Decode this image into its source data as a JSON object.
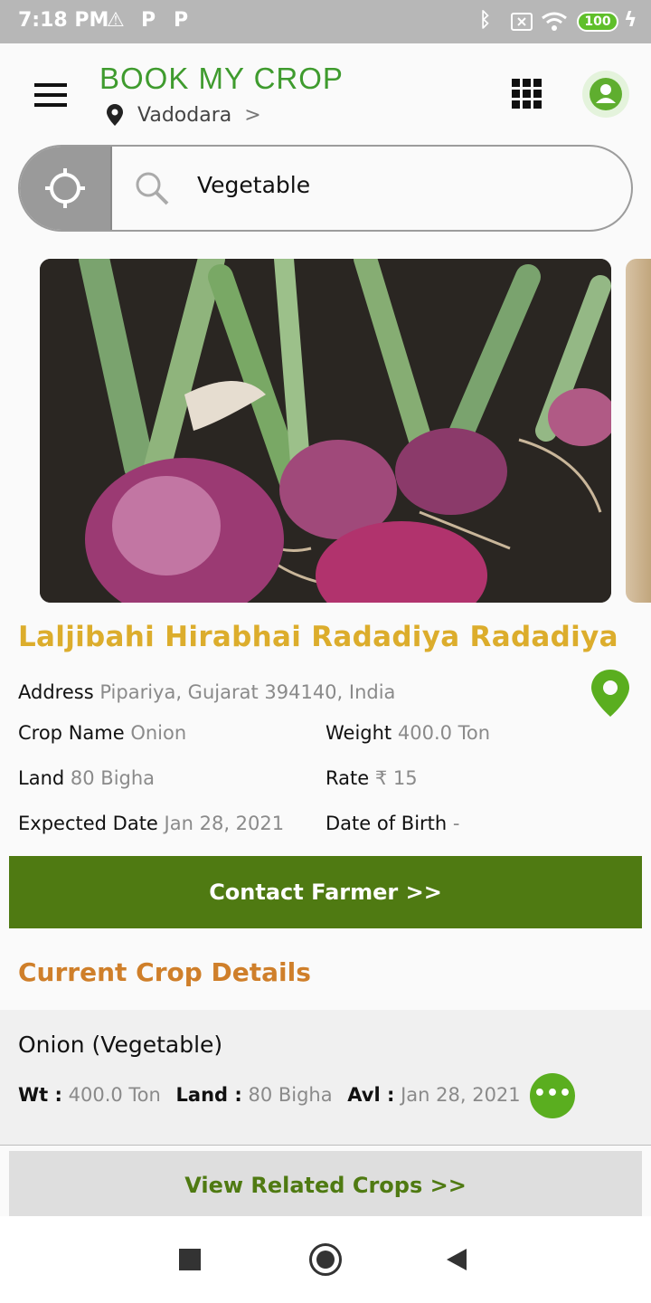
{
  "status_bar": {
    "time": "7:18 PM",
    "notif_icons": [
      "warning-icon",
      "p-icon",
      "p-icon"
    ],
    "battery": "100"
  },
  "header": {
    "logo": "BOOK MY CROP",
    "city": "Vadodara",
    "chevron": ">"
  },
  "search": {
    "query": "Vegetable"
  },
  "farmer": {
    "name": "Laljibahi Hirabhai Radadiya Radadiya",
    "address_label": "Address",
    "address_value": "Pipariya, Gujarat 394140, India",
    "crop_name_label": "Crop Name",
    "crop_name_value": "Onion",
    "weight_label": "Weight",
    "weight_value": "400.0 Ton",
    "land_label": "Land",
    "land_value": "80 Bigha",
    "rate_label": "Rate",
    "rate_value": "₹ 15",
    "expected_date_label": "Expected Date",
    "expected_date_value": "Jan 28, 2021",
    "dob_label": "Date of Birth",
    "dob_value": "-"
  },
  "contact_button": "Contact Farmer >>",
  "current_crop": {
    "section_title": "Current Crop Details",
    "crop_title": "Onion (Vegetable)",
    "wt_label": "Wt :",
    "wt_value": "400.0 Ton",
    "land_label": "Land :",
    "land_value": "80 Bigha",
    "avl_label": "Avl :",
    "avl_value": "Jan 28, 2021",
    "more_symbol": "•••"
  },
  "related_button": "View Related Crops >>",
  "colors": {
    "brand_green": "#3f9b2e",
    "button_green": "#4f7a12",
    "name_gold": "#dcad2c",
    "section_orange": "#cf7f2a"
  }
}
